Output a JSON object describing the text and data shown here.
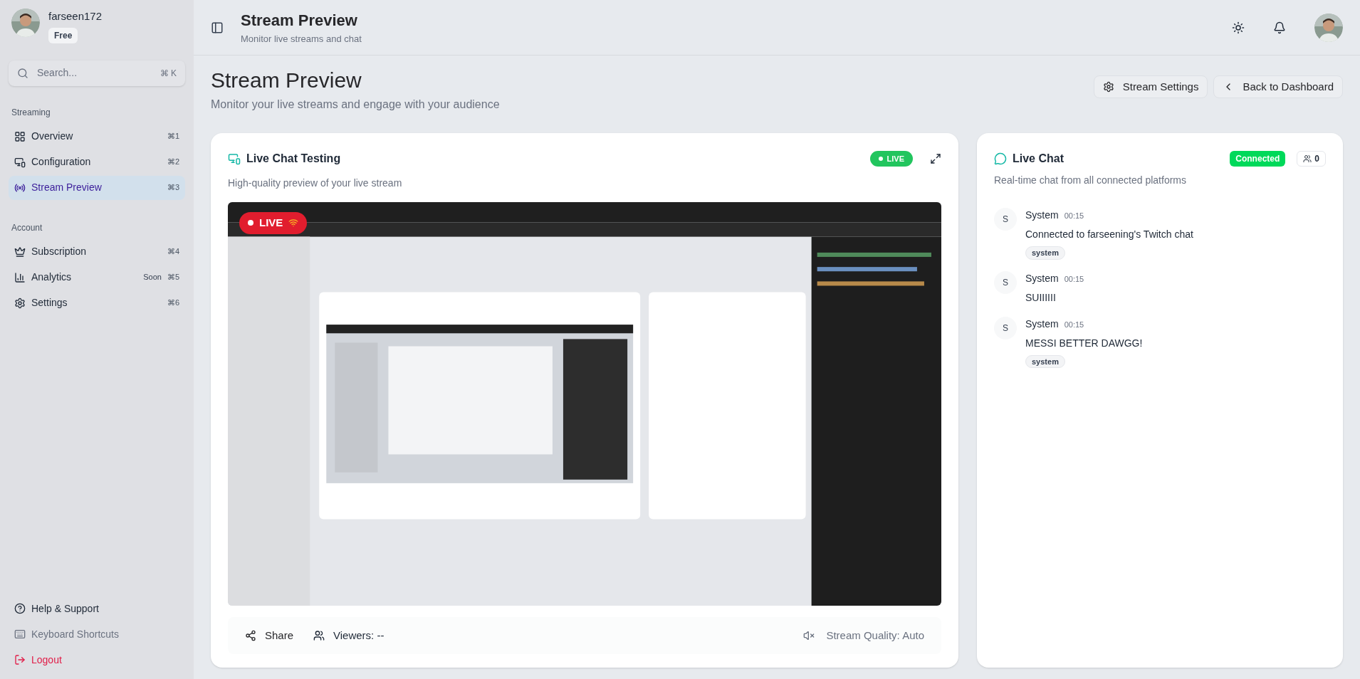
{
  "sidebar": {
    "user": {
      "name": "farseen172",
      "plan": "Free"
    },
    "search": {
      "placeholder": "Search...",
      "shortcut": "⌘ K"
    },
    "sections": [
      {
        "title": "Streaming",
        "items": [
          {
            "label": "Overview",
            "shortcut": "⌘1",
            "kind": "grid",
            "selected": false
          },
          {
            "label": "Configuration",
            "shortcut": "⌘2",
            "kind": "devices",
            "selected": false
          },
          {
            "label": "Stream Preview",
            "shortcut": "⌘3",
            "kind": "radio",
            "selected": true
          }
        ]
      },
      {
        "title": "Account",
        "items": [
          {
            "label": "Subscription",
            "shortcut": "⌘4",
            "kind": "crown",
            "selected": false
          },
          {
            "label": "Analytics",
            "shortcut": "⌘5",
            "badge": "Soon",
            "kind": "chart",
            "selected": false
          },
          {
            "label": "Settings",
            "shortcut": "⌘6",
            "kind": "gear",
            "selected": false
          }
        ]
      }
    ],
    "footer": [
      {
        "label": "Help & Support",
        "kind": "help"
      },
      {
        "label": "Keyboard Shortcuts",
        "kind": "keyboard"
      },
      {
        "label": "Logout",
        "kind": "logout"
      }
    ]
  },
  "header": {
    "title": "Stream Preview",
    "subtitle": "Monitor live streams and chat"
  },
  "page": {
    "title": "Stream Preview",
    "subtitle": "Monitor your live streams and engage with your audience",
    "buttons": [
      {
        "label": "Stream Settings",
        "kind": "settings"
      },
      {
        "label": "Back to Dashboard",
        "kind": "back"
      }
    ]
  },
  "preview": {
    "title": "Live Chat Testing",
    "subtitle": "High-quality preview of your live stream",
    "status": "LIVE",
    "overlay_badge": "LIVE",
    "share": "Share",
    "viewers": "Viewers: --",
    "muted": true,
    "quality": "Stream Quality: Auto"
  },
  "chat": {
    "title": "Live Chat",
    "subtitle": "Real-time chat from all connected platforms",
    "status": "Connected",
    "viewer_count": "0",
    "messages": [
      {
        "initial": "S",
        "author": "System",
        "time": "00:15",
        "text": "Connected to farseening's Twitch chat",
        "tag": "system"
      },
      {
        "initial": "S",
        "author": "System",
        "time": "00:15",
        "text": "SUIIIIII"
      },
      {
        "initial": "S",
        "author": "System",
        "time": "00:15",
        "text": "MESSI BETTER DAWGG!",
        "tag": "system"
      }
    ]
  }
}
